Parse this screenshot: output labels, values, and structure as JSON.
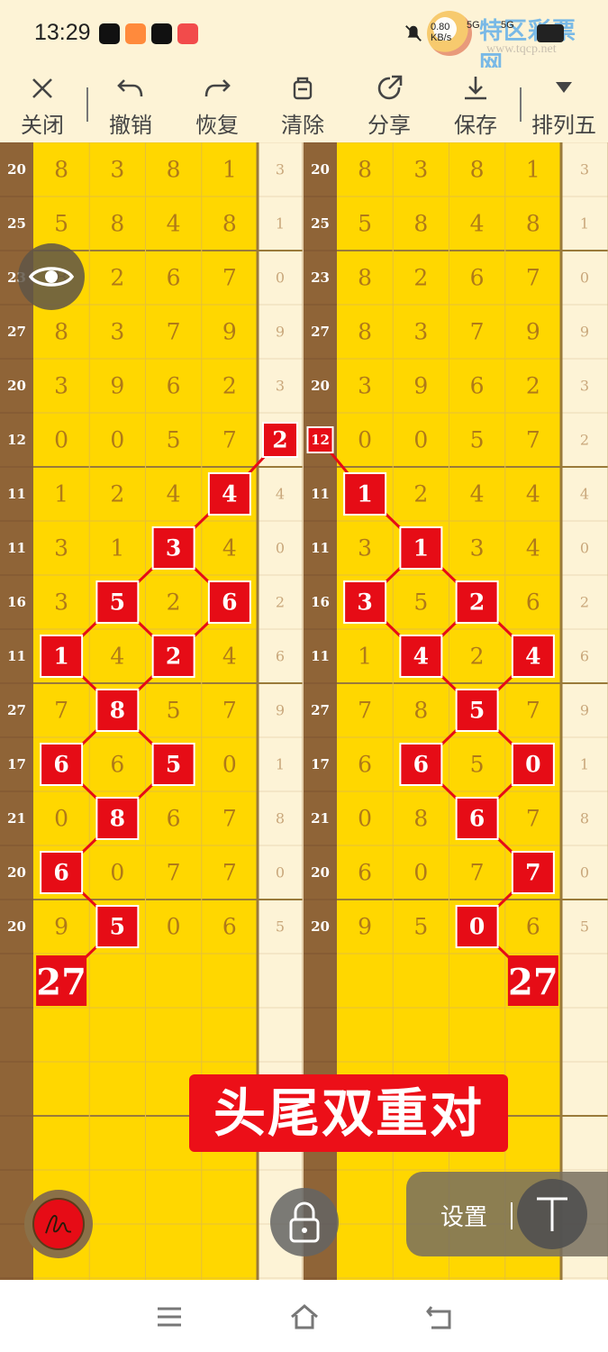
{
  "status_bar": {
    "time": "13:29",
    "network_speed": "0.80 KB/s",
    "signal_labels": [
      "5G",
      "5G"
    ],
    "watermark_title": "特区彩票网",
    "watermark_url": "www.tqcp.net",
    "icons": [
      "tiktok-icon",
      "video-app-icon",
      "tiktok-icon",
      "red-app-icon",
      "mute-bell-icon",
      "signal-icon",
      "battery-icon"
    ]
  },
  "toolbar": {
    "close": "关闭",
    "undo": "撤销",
    "redo": "恢复",
    "clear": "清除",
    "share": "分享",
    "save": "保存",
    "mode": "排列五"
  },
  "board": {
    "rows": [
      {
        "sum": "20",
        "digits": [
          "8",
          "3",
          "8",
          "1"
        ],
        "tail": "3"
      },
      {
        "sum": "25",
        "digits": [
          "5",
          "8",
          "4",
          "8"
        ],
        "tail": "1"
      },
      {
        "sum": "23",
        "digits": [
          "8",
          "2",
          "6",
          "7"
        ],
        "tail": "0"
      },
      {
        "sum": "27",
        "digits": [
          "8",
          "3",
          "7",
          "9"
        ],
        "tail": "9"
      },
      {
        "sum": "20",
        "digits": [
          "3",
          "9",
          "6",
          "2"
        ],
        "tail": "3"
      },
      {
        "sum": "12",
        "digits": [
          "0",
          "0",
          "5",
          "7"
        ],
        "tail": "2"
      },
      {
        "sum": "11",
        "digits": [
          "1",
          "2",
          "4",
          "4"
        ],
        "tail": "4"
      },
      {
        "sum": "11",
        "digits": [
          "3",
          "1",
          "3",
          "4"
        ],
        "tail": "0"
      },
      {
        "sum": "16",
        "digits": [
          "3",
          "5",
          "2",
          "6"
        ],
        "tail": "2"
      },
      {
        "sum": "11",
        "digits": [
          "1",
          "4",
          "2",
          "4"
        ],
        "tail": "6"
      },
      {
        "sum": "27",
        "digits": [
          "7",
          "8",
          "5",
          "7"
        ],
        "tail": "9"
      },
      {
        "sum": "17",
        "digits": [
          "6",
          "6",
          "5",
          "0"
        ],
        "tail": "1"
      },
      {
        "sum": "21",
        "digits": [
          "0",
          "8",
          "6",
          "7"
        ],
        "tail": "8"
      },
      {
        "sum": "20",
        "digits": [
          "6",
          "0",
          "7",
          "7"
        ],
        "tail": "0"
      },
      {
        "sum": "20",
        "digits": [
          "9",
          "5",
          "0",
          "6"
        ],
        "tail": "5"
      }
    ],
    "left_highlights": [
      [
        5,
        4
      ],
      [
        6,
        3
      ],
      [
        7,
        2
      ],
      [
        9,
        0
      ],
      [
        8,
        1
      ],
      [
        8,
        3
      ],
      [
        9,
        2
      ],
      [
        10,
        1
      ],
      [
        11,
        0
      ],
      [
        11,
        2
      ],
      [
        12,
        1
      ],
      [
        13,
        0
      ],
      [
        14,
        1
      ]
    ],
    "right_highlights": [
      [
        5,
        -1
      ],
      [
        6,
        0
      ],
      [
        7,
        1
      ],
      [
        8,
        0
      ],
      [
        8,
        2
      ],
      [
        9,
        1
      ],
      [
        9,
        3
      ],
      [
        10,
        2
      ],
      [
        11,
        1
      ],
      [
        11,
        3
      ],
      [
        12,
        2
      ],
      [
        13,
        3
      ],
      [
        14,
        2
      ]
    ],
    "left_result": "27",
    "right_result": "27",
    "colors": {
      "board_yellow": "#ffd700",
      "sum_column": "#8f6437",
      "tail_column": "#fdf3d6",
      "highlight_red": "#e60c16",
      "digit_brown": "#b07a18"
    }
  },
  "banner_text": "头尾双重对",
  "settings_label": "设置",
  "floating_icons": [
    "eye-icon",
    "pen-icon",
    "lock-icon",
    "text-tool-icon"
  ],
  "nav_icons": [
    "menu-icon",
    "home-icon",
    "back-icon"
  ]
}
